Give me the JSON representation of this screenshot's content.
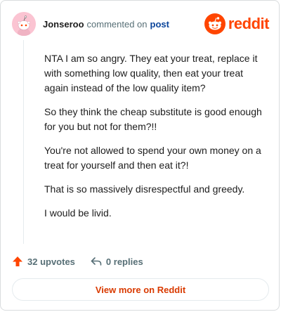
{
  "comment": {
    "username": "Jonseroo",
    "action_text": "commented on",
    "post_link_text": "post",
    "avatar_icon": "snoo-avatar-icon",
    "paragraphs": [
      "NTA I am so angry. They eat your treat, replace it with something low quality, then eat your treat again instead of the low quality item?",
      "So they think the cheap substitute is good enough for you but not for them?!!",
      "You're not allowed to spend your own money on a treat for yourself and then eat it?!",
      "That is so massively disrespectful and greedy.",
      "I would be livid."
    ],
    "upvotes_label": "32 upvotes",
    "replies_label": "0 replies"
  },
  "brand": {
    "wordmark": "reddit",
    "logo_icon": "reddit-logo-icon",
    "color": "#ff4500"
  },
  "cta": {
    "label": "View more on Reddit",
    "color": "#d93a00"
  },
  "icons": {
    "upvote": "upvote-arrow-icon",
    "reply": "reply-arrow-icon"
  }
}
